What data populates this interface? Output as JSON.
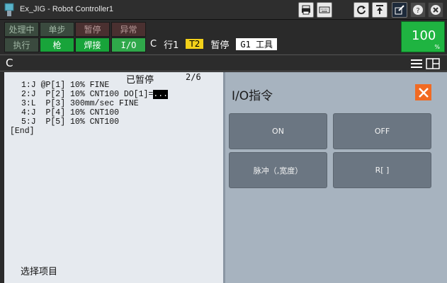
{
  "window": {
    "title": "Ex_JIG - Robot Controller1"
  },
  "toolbar": {
    "icons": [
      "print-icon",
      "keyboard-icon",
      "refresh-icon",
      "up-down-icon",
      "edit-icon",
      "help-icon",
      "close-icon"
    ]
  },
  "status": {
    "row1": [
      "处理中",
      "单步",
      "暂停",
      "异常"
    ],
    "row2": [
      "执行",
      "枪",
      "焊接",
      "I/O"
    ],
    "line": {
      "c": "C",
      "line_no": "行1",
      "mode": "T2",
      "state": "暂停",
      "group": "G1 工具"
    },
    "override": {
      "value": "100",
      "unit": "%"
    }
  },
  "breadcrumb": {
    "letter": "C"
  },
  "program": {
    "paused_label": "已暂停",
    "line_count": "2/6",
    "lines": [
      "1:J @P[1] 10% FINE",
      "2:J  P[2] 10% CNT100 DO[1]=",
      "3:L  P[3] 300mm/sec FINE",
      "4:J  P[4] 10% CNT100",
      "5:J  P[5] 10% CNT100",
      "[End]"
    ],
    "cursor_value": "...",
    "prompt": "选择项目"
  },
  "io_panel": {
    "title": "I/O指令",
    "buttons": [
      "ON",
      "OFF",
      "脉冲（,宽度）",
      "R[ ]"
    ]
  },
  "colors": {
    "accent_orange": "#f16a22",
    "status_green": "#1fb441",
    "mode_yellow": "#f3d11a"
  }
}
